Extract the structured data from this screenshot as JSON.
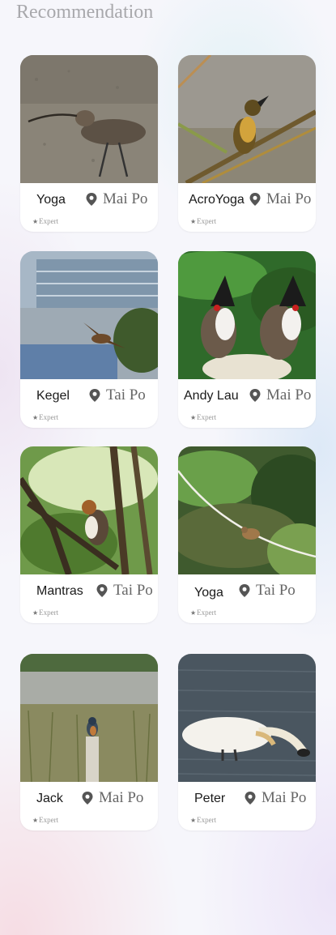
{
  "page": {
    "title": "Recommendation"
  },
  "cards": [
    {
      "name": "Yoga",
      "location": "Mai Po",
      "level": "Expert",
      "star": "★",
      "pin_icon": "location-pin-icon"
    },
    {
      "name": "AcroYoga",
      "location": "Mai Po",
      "level": "Expert",
      "star": "★",
      "pin_icon": "location-pin-icon"
    },
    {
      "name": "Kegel",
      "location": "Tai Po",
      "level": "Expert",
      "star": "★",
      "pin_icon": "location-pin-icon"
    },
    {
      "name": "Andy Lau",
      "location": "Mai Po",
      "level": "Expert",
      "star": "★",
      "pin_icon": "location-pin-icon"
    },
    {
      "name": "Mantras",
      "location": "Tai Po",
      "level": "Expert",
      "star": "★",
      "pin_icon": "location-pin-icon"
    },
    {
      "name": "Yoga",
      "location": "Tai Po",
      "level": "Expert",
      "star": "★",
      "pin_icon": "location-pin-icon"
    },
    {
      "name": "Jack",
      "location": "Mai Po",
      "level": "Expert",
      "star": "★",
      "pin_icon": "location-pin-icon"
    },
    {
      "name": "Peter",
      "location": "Mai Po",
      "level": "Expert",
      "star": "★",
      "pin_icon": "location-pin-icon"
    }
  ],
  "colors": {
    "pin": "#555555",
    "title": "#a8a8ac",
    "card": "#ffffff"
  }
}
